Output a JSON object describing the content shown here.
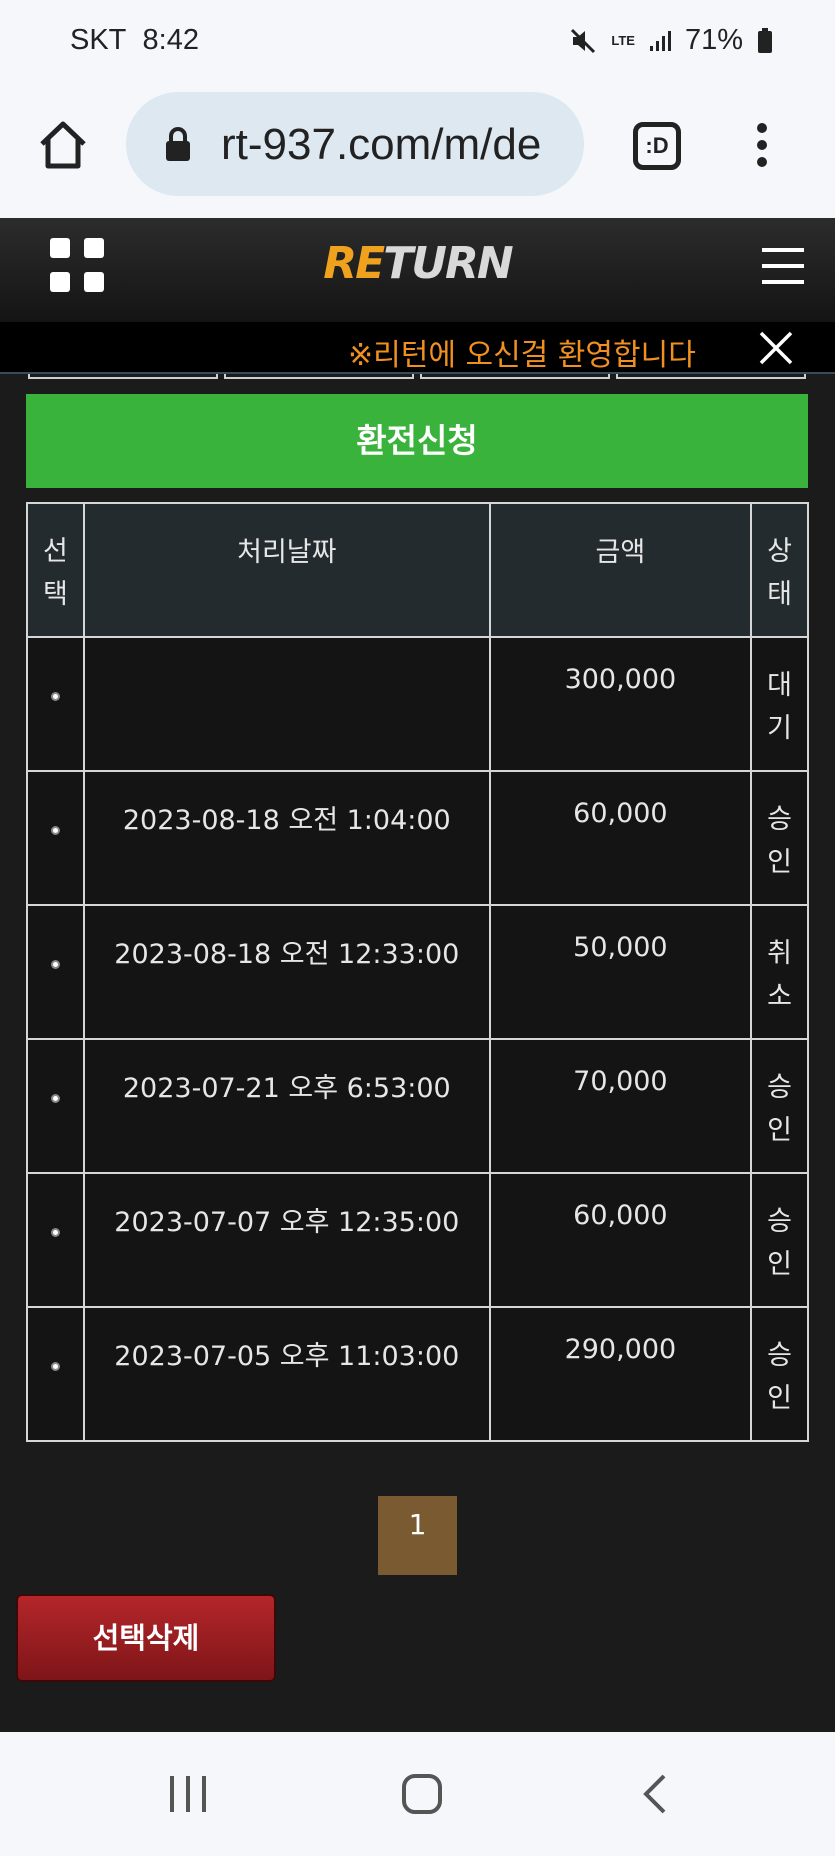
{
  "status_bar": {
    "carrier": "SKT",
    "time": "8:42",
    "network": "LTE",
    "battery": "71%"
  },
  "browser": {
    "url": "rt-937.com/m/de",
    "tabs_label": ":D"
  },
  "site": {
    "logo_part1": "RE",
    "logo_part2": "TURN",
    "marquee": "※리턴에 오신걸 환영합니다"
  },
  "exchange_button": "환전신청",
  "table": {
    "headers": [
      "선택",
      "처리날짜",
      "금액",
      "상태"
    ],
    "rows": [
      {
        "date": "",
        "amount": "300,000",
        "status": "대기"
      },
      {
        "date": "2023-08-18 오전 1:04:00",
        "amount": "60,000",
        "status": "승인"
      },
      {
        "date": "2023-08-18 오전 12:33:00",
        "amount": "50,000",
        "status": "취소"
      },
      {
        "date": "2023-07-21 오후 6:53:00",
        "amount": "70,000",
        "status": "승인"
      },
      {
        "date": "2023-07-07 오후 12:35:00",
        "amount": "60,000",
        "status": "승인"
      },
      {
        "date": "2023-07-05 오후 11:03:00",
        "amount": "290,000",
        "status": "승인"
      }
    ]
  },
  "pagination": {
    "current": "1"
  },
  "delete_button": "선택삭제"
}
